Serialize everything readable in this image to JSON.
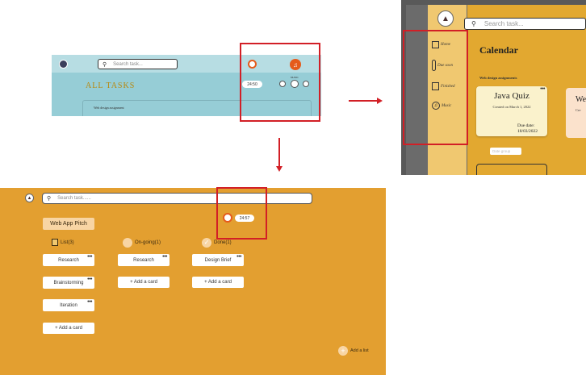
{
  "panel_a": {
    "search_placeholder": "Search task...",
    "title": "ALL TASKS",
    "timer": "24:50",
    "music_label": "MUSIC",
    "section_label": "Web design assignment"
  },
  "panel_b": {
    "search_placeholder": "Search task...",
    "page_title": "Calendar",
    "sidebar": [
      {
        "label": "Home",
        "icon": "home-icon"
      },
      {
        "label": "Due soon",
        "icon": "thermometer-icon"
      },
      {
        "label": "Finished",
        "icon": "save-icon"
      },
      {
        "label": "Music",
        "icon": "music-icon"
      }
    ],
    "section_label": "Web design assignments",
    "card": {
      "title": "Java Quiz",
      "created": "Created on March 1, 2022",
      "due_label": "Due date:",
      "due_date": "18/03/2022"
    },
    "card2_title": "We",
    "card2_sub": "Cre",
    "input_placeholder": "Date group"
  },
  "panel_c": {
    "search_placeholder": "Search task......",
    "timer": "24:57",
    "board_button": "Web App Pitch",
    "columns": [
      {
        "title": "List(3)",
        "cards": [
          "Research",
          "Brainstorming",
          "Iteration"
        ],
        "add": "+ Add a card"
      },
      {
        "title": "On-going(1)",
        "cards": [
          "Research"
        ],
        "add": "+ Add a card"
      },
      {
        "title": "Done(1)",
        "cards": [
          "Design Brief"
        ],
        "add": "+ Add a card"
      }
    ],
    "add_list": "Add a list"
  },
  "colors": {
    "highlight": "#d21f26",
    "orange_bg": "#e39f30",
    "teal_bg": "#96cdd6",
    "sidebar_bg": "#f0c870"
  }
}
